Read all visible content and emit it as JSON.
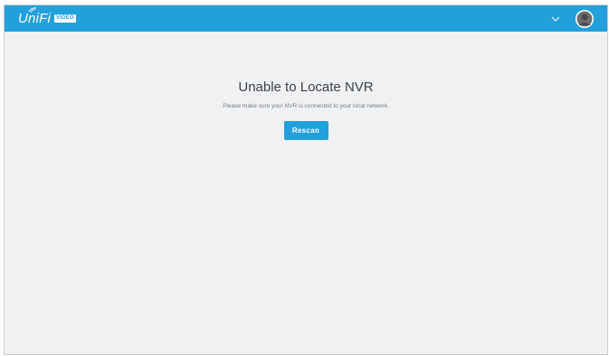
{
  "header": {
    "logo_text": "UniFi",
    "logo_badge": "VIDEO",
    "menu_icon": "chevron-down-icon",
    "avatar_icon": "user-avatar-icon",
    "brand_color": "#22a0dc"
  },
  "main": {
    "title": "Unable to Locate NVR",
    "message": "Please make sure your NVR is connected to your local network.",
    "rescan_label": "Rescan"
  }
}
